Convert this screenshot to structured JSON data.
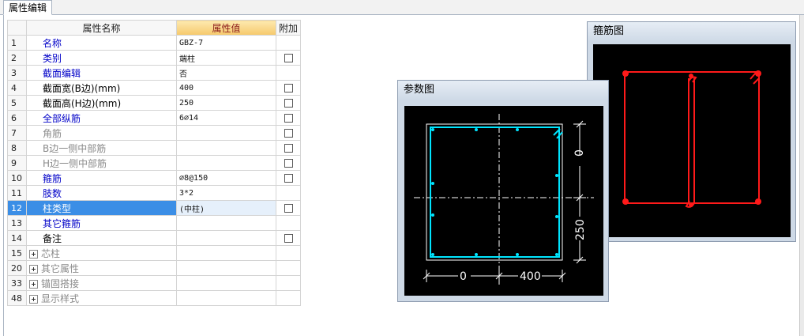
{
  "tab": {
    "label": "属性编辑"
  },
  "grid": {
    "headers": {
      "name": "属性名称",
      "value": "属性值",
      "extra": "附加"
    },
    "rows": [
      {
        "num": "1",
        "name": "名称",
        "value": "GBZ-7",
        "style": "blue",
        "checkbox": false
      },
      {
        "num": "2",
        "name": "类别",
        "value": "端柱",
        "style": "blue",
        "checkbox": true
      },
      {
        "num": "3",
        "name": "截面编辑",
        "value": "否",
        "style": "blue",
        "checkbox": false
      },
      {
        "num": "4",
        "name": "截面宽(B边)(mm)",
        "value": "400",
        "style": "plain",
        "checkbox": true
      },
      {
        "num": "5",
        "name": "截面高(H边)(mm)",
        "value": "250",
        "style": "plain",
        "checkbox": true
      },
      {
        "num": "6",
        "name": "全部纵筋",
        "value": "6⌀14",
        "style": "blue",
        "checkbox": true
      },
      {
        "num": "7",
        "name": "角筋",
        "value": "",
        "style": "gray",
        "checkbox": true
      },
      {
        "num": "8",
        "name": "B边一侧中部筋",
        "value": "",
        "style": "gray",
        "checkbox": true
      },
      {
        "num": "9",
        "name": "H边一侧中部筋",
        "value": "",
        "style": "gray",
        "checkbox": true
      },
      {
        "num": "10",
        "name": "箍筋",
        "value": "⌀8@150",
        "style": "blue",
        "checkbox": true
      },
      {
        "num": "11",
        "name": "肢数",
        "value": "3*2",
        "style": "blue",
        "checkbox": false
      },
      {
        "num": "12",
        "name": "柱类型",
        "value": "(中柱)",
        "style": "blue",
        "checkbox": true,
        "selected": true
      },
      {
        "num": "13",
        "name": "其它箍筋",
        "value": "",
        "style": "blue",
        "checkbox": false
      },
      {
        "num": "14",
        "name": "备注",
        "value": "",
        "style": "plain",
        "checkbox": true
      },
      {
        "num": "15",
        "name": "芯柱",
        "value": "",
        "style": "group",
        "checkbox": false
      },
      {
        "num": "20",
        "name": "其它属性",
        "value": "",
        "style": "group",
        "checkbox": false
      },
      {
        "num": "33",
        "name": "锚固搭接",
        "value": "",
        "style": "group",
        "checkbox": false
      },
      {
        "num": "48",
        "name": "显示样式",
        "value": "",
        "style": "group",
        "checkbox": false
      }
    ]
  },
  "stirrup_window": {
    "title": "箍筋图"
  },
  "param_window": {
    "title": "参数图",
    "dim_left": "0",
    "dim_right": "400",
    "dim_top": "0",
    "dim_bottom": "250"
  },
  "colors": {
    "cyan": "#00e5ff",
    "red": "#ff1a1a",
    "white": "#ffffff",
    "selected": "#3b8ee6",
    "header_value": "#f6c96b"
  }
}
